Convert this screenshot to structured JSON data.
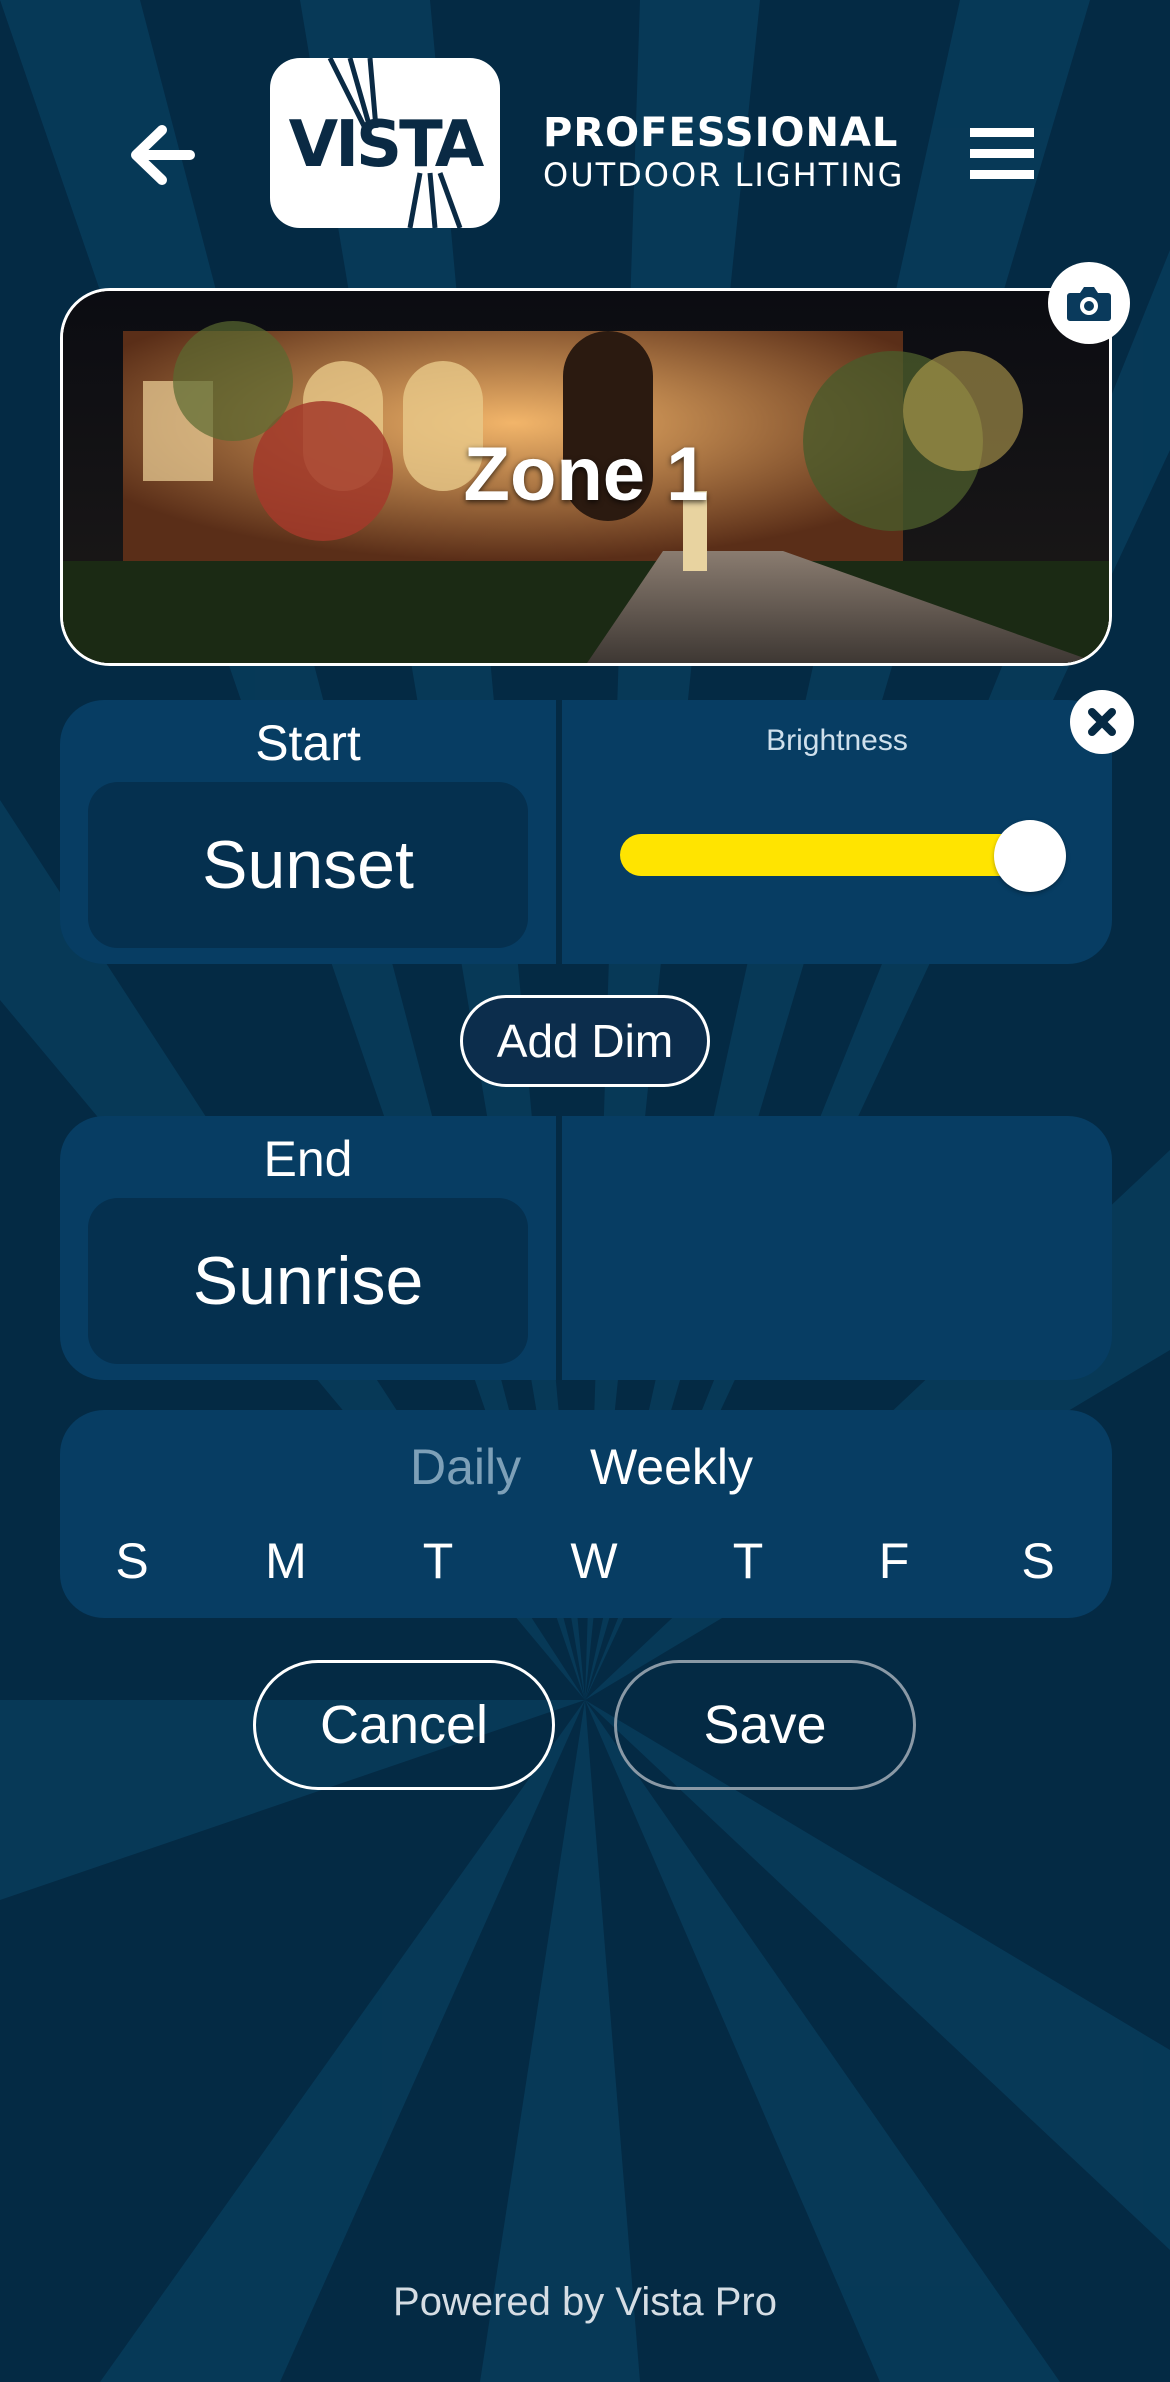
{
  "header": {
    "back_icon": "arrow-left-icon",
    "menu_icon": "hamburger-menu-icon",
    "logo_text": "VISTA",
    "brand_line1": "PROFESSIONAL",
    "brand_line2": "OUTDOOR LIGHTING"
  },
  "zone": {
    "title": "Zone 1",
    "camera_icon": "camera-icon"
  },
  "start": {
    "label": "Start",
    "value": "Sunset",
    "brightness_label": "Brightness",
    "brightness_level": 1.0,
    "slider_color": "#ffe400",
    "remove_icon": "close-circle-icon"
  },
  "add_dim_label": "Add Dim",
  "end": {
    "label": "End",
    "value": "Sunrise"
  },
  "schedule": {
    "tabs": [
      "Daily",
      "Weekly"
    ],
    "active_tab": "Weekly",
    "days": [
      "S",
      "M",
      "T",
      "W",
      "T",
      "F",
      "S"
    ]
  },
  "actions": {
    "cancel_label": "Cancel",
    "save_label": "Save"
  },
  "footer_text": "Powered by Vista Pro",
  "colors": {
    "background": "#042a44",
    "panel": "#073d63",
    "accent": "#ffe400"
  }
}
